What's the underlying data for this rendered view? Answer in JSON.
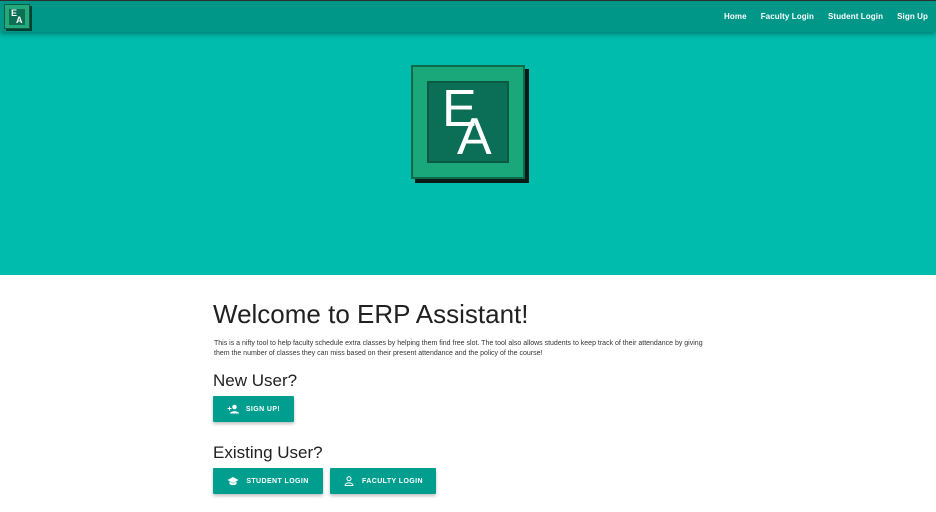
{
  "navbar": {
    "logo_letters": [
      "E",
      "A"
    ],
    "links": [
      "Home",
      "Faculty Login",
      "Student Login",
      "Sign Up"
    ]
  },
  "hero": {
    "logo_letters": [
      "E",
      "A"
    ]
  },
  "main": {
    "title": "Welcome to ERP Assistant!",
    "description": "This is a nifty tool to help faculty schedule extra classes by helping them find free slot. The tool also allows students to keep track of their attendance by giving them the number of classes they can miss based on their present attendance and the policy of the course!",
    "new_user_heading": "New User?",
    "signup_label": "SIGN UP!",
    "existing_user_heading": "Existing User?",
    "student_login_label": "STUDENT LOGIN",
    "faculty_login_label": "FACULTY LOGIN"
  },
  "icons": {
    "signup": "person-add-icon",
    "student": "graduation-cap-icon",
    "faculty": "person-icon"
  },
  "colors": {
    "navbar": "#009688",
    "hero": "#00bcad",
    "button": "#009e8f",
    "logo_outer": "#1aa77a",
    "logo_inner": "#0b6e56"
  }
}
